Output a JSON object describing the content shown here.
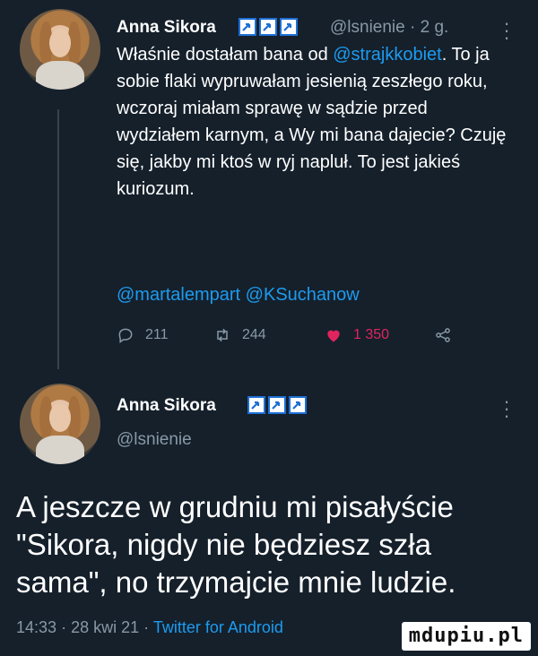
{
  "tweet1": {
    "author_name": "Anna Sikora",
    "handle": "@lsnienie",
    "time_sep": "·",
    "time": "2 g.",
    "body_prefix": "Właśnie dostałam bana od ",
    "mention_main": "@strajkkobiet",
    "body_suffix": ". To ja sobie flaki wypruwałam jesienią zeszłego roku, wczoraj miałam sprawę w sądzie przed wydziałem karnym, a Wy mi bana dajecie? Czuję się, jakby mi ktoś w ryj napluł. To jest jakieś kuriozum.",
    "mentions_footer": "@martalempart @KSuchanow",
    "reply_count": "211",
    "retweet_count": "244",
    "like_count": "1 350"
  },
  "tweet2": {
    "author_name": "Anna Sikora",
    "handle": "@lsnienie",
    "text": "A jeszcze w grudniu mi pisałyście \"Sikora, nigdy nie będziesz szła sama\", no trzymajcie mnie ludzie.",
    "time": "14:33",
    "date": "28 kwi 21",
    "sep": "·",
    "client": "Twitter for Android"
  },
  "icons": {
    "badge": "checkmark-flag-icon",
    "reply": "reply-icon",
    "retweet": "retweet-icon",
    "like": "heart-icon",
    "share": "share-icon",
    "more": "more-icon"
  },
  "colors": {
    "background": "#15202b",
    "accent": "#1d9bf0",
    "muted": "#8899a6",
    "like": "#e0245e",
    "badge_border": "#1d6fd6"
  },
  "watermark": "mdupiu.pl"
}
